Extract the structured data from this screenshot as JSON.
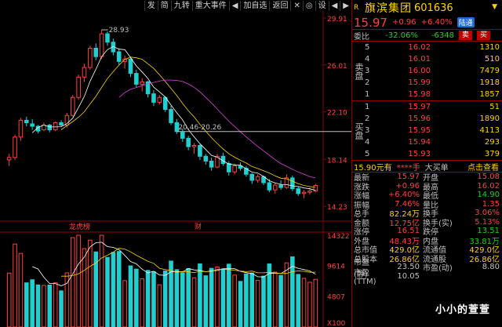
{
  "toolbar": {
    "items": [
      "发",
      "简",
      "九转",
      "重大事件",
      "◀",
      "加自选",
      "返回",
      "✕",
      "◎",
      "设",
      "◀",
      "▶"
    ]
  },
  "chart": {
    "price_axis": [
      "29.91",
      "26.01",
      "22.10",
      "18.14",
      "14.23"
    ],
    "vol_axis": [
      "14322",
      "9614",
      "4807",
      "X100"
    ],
    "annotations": {
      "high": "28.93",
      "band": "20.46-20.26"
    },
    "markers": [
      "龙虎榜",
      "财"
    ]
  },
  "chart_data": {
    "type": "candlestick",
    "candles": [
      [
        18.1,
        18.6,
        17.6,
        18.3
      ],
      [
        18.3,
        20.2,
        18.1,
        20.0
      ],
      [
        20.0,
        21.6,
        19.7,
        21.4
      ],
      [
        21.4,
        21.7,
        20.9,
        21.2
      ],
      [
        21.1,
        21.5,
        20.6,
        20.9
      ],
      [
        20.9,
        21.0,
        20.3,
        20.5
      ],
      [
        20.6,
        21.2,
        20.5,
        21.0
      ],
      [
        21.0,
        21.1,
        20.4,
        20.6
      ],
      [
        20.6,
        21.3,
        20.5,
        21.2
      ],
      [
        21.2,
        21.4,
        20.9,
        21.0
      ],
      [
        21.0,
        22.0,
        20.8,
        21.8
      ],
      [
        21.8,
        23.5,
        21.7,
        23.3
      ],
      [
        23.3,
        25.2,
        23.1,
        25.0
      ],
      [
        25.0,
        26.1,
        24.6,
        25.8
      ],
      [
        25.8,
        27.6,
        25.6,
        27.4
      ],
      [
        27.4,
        27.8,
        26.4,
        26.7
      ],
      [
        26.7,
        28.93,
        26.5,
        28.6
      ],
      [
        28.6,
        28.8,
        27.6,
        27.9
      ],
      [
        27.9,
        28.2,
        26.8,
        27.1
      ],
      [
        27.1,
        27.4,
        26.0,
        26.3
      ],
      [
        26.3,
        26.8,
        25.7,
        26.5
      ],
      [
        26.5,
        26.7,
        25.0,
        25.3
      ],
      [
        25.3,
        25.6,
        24.1,
        24.4
      ],
      [
        24.4,
        24.9,
        23.8,
        24.6
      ],
      [
        24.6,
        24.7,
        23.3,
        23.6
      ],
      [
        23.6,
        23.9,
        22.6,
        22.9
      ],
      [
        22.9,
        23.5,
        22.7,
        23.3
      ],
      [
        23.3,
        23.4,
        22.1,
        22.3
      ],
      [
        22.3,
        22.6,
        21.0,
        21.2
      ],
      [
        21.2,
        21.5,
        20.26,
        20.46
      ],
      [
        20.4,
        20.7,
        19.6,
        19.9
      ],
      [
        19.9,
        20.1,
        18.9,
        19.2
      ],
      [
        19.2,
        19.5,
        18.6,
        19.3
      ],
      [
        19.3,
        19.4,
        18.1,
        18.4
      ],
      [
        18.4,
        18.6,
        17.7,
        18.0
      ],
      [
        18.0,
        18.3,
        17.2,
        17.5
      ],
      [
        17.5,
        18.6,
        17.4,
        18.4
      ],
      [
        18.4,
        18.7,
        17.6,
        17.8
      ],
      [
        17.8,
        18.0,
        16.8,
        17.1
      ],
      [
        17.1,
        17.8,
        16.9,
        17.6
      ],
      [
        17.6,
        17.9,
        17.2,
        17.4
      ],
      [
        17.4,
        17.6,
        16.7,
        16.9
      ],
      [
        16.9,
        17.0,
        16.1,
        16.4
      ],
      [
        16.4,
        16.9,
        16.2,
        16.7
      ],
      [
        16.7,
        16.8,
        16.0,
        16.2
      ],
      [
        16.2,
        16.5,
        15.4,
        15.6
      ],
      [
        15.6,
        16.2,
        15.3,
        16.0
      ],
      [
        16.0,
        16.4,
        15.6,
        15.8
      ],
      [
        15.8,
        16.9,
        15.7,
        16.6
      ],
      [
        16.6,
        16.8,
        15.5,
        15.7
      ],
      [
        15.7,
        15.9,
        15.1,
        15.3
      ],
      [
        15.3,
        15.6,
        14.9,
        15.4
      ],
      [
        15.4,
        15.8,
        15.2,
        15.5
      ],
      [
        15.5,
        16.1,
        15.4,
        15.97
      ]
    ],
    "volume_ticks": [
      "14322",
      "9614",
      "4807",
      "X100"
    ],
    "ylim": [
      13.0,
      30.5
    ]
  },
  "quote": {
    "name": "旗滨集团",
    "code": "601636",
    "flag": "R",
    "price": "15.97",
    "change": "+0.96",
    "pct": "+6.40%",
    "tag": "陆通",
    "weibi_label": "委比",
    "weibi_pct": "-32.06%",
    "weibi_diff": "-6348",
    "sell_btn": "卖",
    "buy_btn": "买",
    "sell_side": "卖盘",
    "buy_side": "买盘",
    "asks": [
      {
        "n": "5",
        "p": "16.02",
        "q": "1310"
      },
      {
        "n": "4",
        "p": "16.01",
        "q": "510"
      },
      {
        "n": "3",
        "p": "16.00",
        "q": "7479"
      },
      {
        "n": "2",
        "p": "15.99",
        "q": "1918"
      },
      {
        "n": "1",
        "p": "15.98",
        "q": "1857"
      }
    ],
    "bids": [
      {
        "n": "1",
        "p": "15.97",
        "q": "51"
      },
      {
        "n": "2",
        "p": "15.96",
        "q": "1890"
      },
      {
        "n": "3",
        "p": "15.95",
        "q": "4113"
      },
      {
        "n": "4",
        "p": "15.94",
        "q": "293"
      },
      {
        "n": "5",
        "p": "15.93",
        "q": "379"
      }
    ],
    "mid": {
      "a": "15.90元有",
      "b": "****手",
      "c": "大买单",
      "d": "点击查看"
    },
    "stats": [
      {
        "k": "最新",
        "v": "15.97",
        "k2": "开盘",
        "v2": "15.08"
      },
      {
        "k": "涨跌",
        "v": "+0.96",
        "k2": "最高",
        "v2": "16.02"
      },
      {
        "k": "涨幅",
        "v": "+6.40%",
        "k2": "最低",
        "v2": "14.90"
      },
      {
        "k": "振幅",
        "v": "7.46%",
        "k2": "量比",
        "v2": "1.35"
      },
      {
        "k": "总手",
        "v": "82.24万",
        "k2": "换手",
        "v2": "3.06%"
      },
      {
        "k": "金额",
        "v": "12.75亿",
        "k2": "换手(实)",
        "v2": "5.13%"
      },
      {
        "k": "涨停",
        "v": "16.51",
        "k2": "跌停",
        "v2": "13.51"
      },
      {
        "k": "外盘",
        "v": "48.43万",
        "k2": "内盘",
        "v2": "33.81万"
      },
      {
        "k": "总市值",
        "v": "429.0亿",
        "k2": "流通值",
        "v2": "429.0亿"
      },
      {
        "k": "总股本",
        "v": "26.86亿",
        "k2": "流通股",
        "v2": "26.86亿"
      },
      {
        "k": "市盈(静)",
        "v": "23.50",
        "k2": "市盈(动)",
        "v2": "8.80"
      },
      {
        "k": "市盈(TTM)",
        "v": "10.05",
        "k2": "",
        "v2": ""
      }
    ],
    "watermark": "小小的萱萱"
  },
  "colors": {
    "up": "#ff4040",
    "down": "#20d0d0",
    "grid": "#8b0000",
    "yellow": "#ffd400",
    "green": "#20d020"
  }
}
